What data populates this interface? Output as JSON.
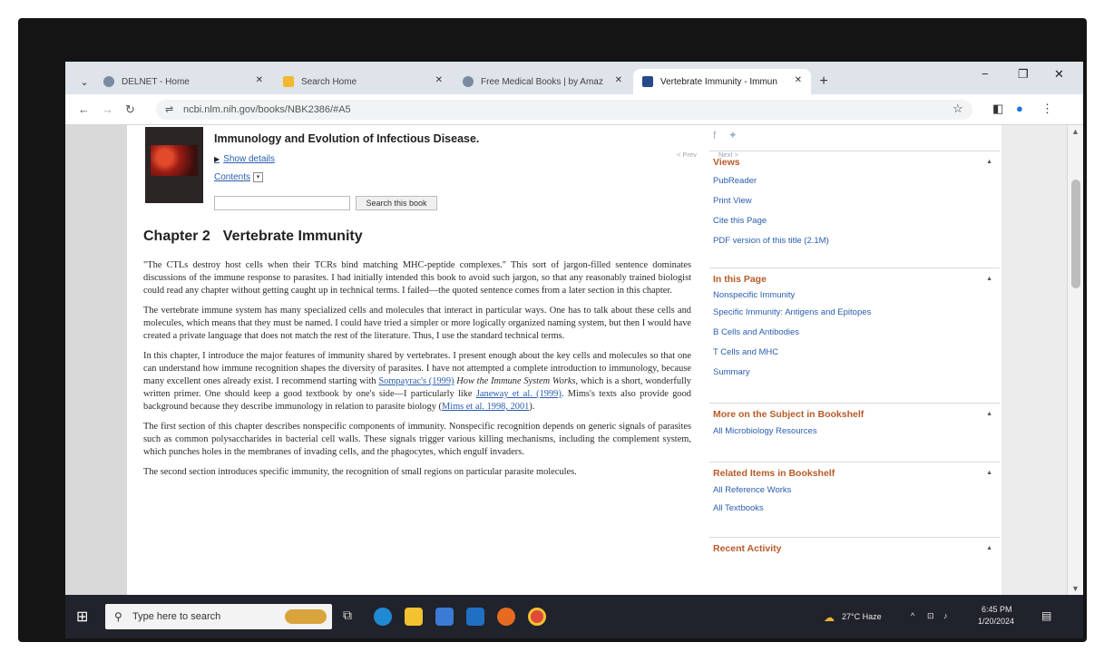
{
  "browser": {
    "tabs": [
      {
        "label": "DELNET - Home",
        "icon": "globe-icon",
        "active": false
      },
      {
        "label": "Search Home",
        "icon": "search-site-icon",
        "active": false
      },
      {
        "label": "Free Medical Books | by Amaz",
        "icon": "globe-icon",
        "active": false
      },
      {
        "label": "Vertebrate Immunity - Immun",
        "icon": "bookshelf-icon",
        "active": true
      }
    ],
    "tab_close_glyph": "✕",
    "new_tab_glyph": "+",
    "url": "ncbi.nlm.nih.gov/books/NBK2386/#A5",
    "window_controls": {
      "minimize": "−",
      "maximize": "❐",
      "close": "✕"
    }
  },
  "book": {
    "title": "Immunology and Evolution of Infectious Disease.",
    "show_details": "Show details",
    "contents": "Contents",
    "search_button": "Search this book",
    "prev": "< Prev",
    "next": "Next >"
  },
  "chapter": {
    "number": "Chapter 2",
    "title": "Vertebrate Immunity"
  },
  "article": {
    "p1": "\"The CTLs destroy host cells when their TCRs bind matching MHC-peptide complexes.\" This sort of jargon-filled sentence dominates discussions of the immune response to parasites. I had initially intended this book to avoid such jargon, so that any reasonably trained biologist could read any chapter without getting caught up in technical terms. I failed—the quoted sentence comes from a later section in this chapter.",
    "p2": "The vertebrate immune system has many specialized cells and molecules that interact in particular ways. One has to talk about these cells and molecules, which means that they must be named. I could have tried a simpler or more logically organized naming system, but then I would have created a private language that does not match the rest of the literature. Thus, I use the standard technical terms.",
    "p3_a": "In this chapter, I introduce the major features of immunity shared by vertebrates. I present enough about the key cells and molecules so that one can understand how immune recognition shapes the diversity of parasites. I have not attempted a complete introduction to immunology, because many excellent ones already exist. I recommend starting with ",
    "p3_link1": "Sompayrac's (1999)",
    "p3_b": " ",
    "p3_em": "How the Immune System Works",
    "p3_c": ", which is a short, wonderfully written primer. One should keep a good textbook by one's side—I particularly like ",
    "p3_link2": "Janeway et al. (1999)",
    "p3_d": ". Mims's texts also provide good background because they describe immunology in relation to parasite biology (",
    "p3_link3": "Mims et al. 1998, 2001",
    "p3_e": ").",
    "p4": "The first section of this chapter describes nonspecific components of immunity. Nonspecific recognition depends on generic signals of parasites such as common polysaccharides in bacterial cell walls. These signals trigger various killing mechanisms, including the complement system, which punches holes in the membranes of invading cells, and the phagocytes, which engulf invaders.",
    "p5": "The second section introduces specific immunity, the recognition of small regions on particular parasite molecules."
  },
  "sidebar": {
    "views": {
      "title": "Views",
      "items": [
        "PubReader",
        "Print View",
        "Cite this Page",
        "PDF version of this title (2.1M)"
      ]
    },
    "in_this_page": {
      "title": "In this Page",
      "items": [
        "Nonspecific Immunity",
        "Specific Immunity: Antigens and Epitopes",
        "B Cells and Antibodies",
        "T Cells and MHC",
        "Summary"
      ]
    },
    "more_on_subject": {
      "title": "More on the Subject in Bookshelf",
      "items": [
        "All Microbiology Resources"
      ]
    },
    "related_items": {
      "title": "Related Items in Bookshelf",
      "items": [
        "All Reference Works",
        "All Textbooks"
      ]
    },
    "recent_activity": {
      "title": "Recent Activity"
    }
  },
  "taskbar": {
    "search_placeholder": "Type here to search",
    "weather": "27°C  Haze",
    "time": "6:45 PM",
    "date": "1/20/2024"
  },
  "colors": {
    "link": "#2a5db0",
    "sidebar_heading": "#b85a28",
    "taskbar": "#20232b"
  }
}
